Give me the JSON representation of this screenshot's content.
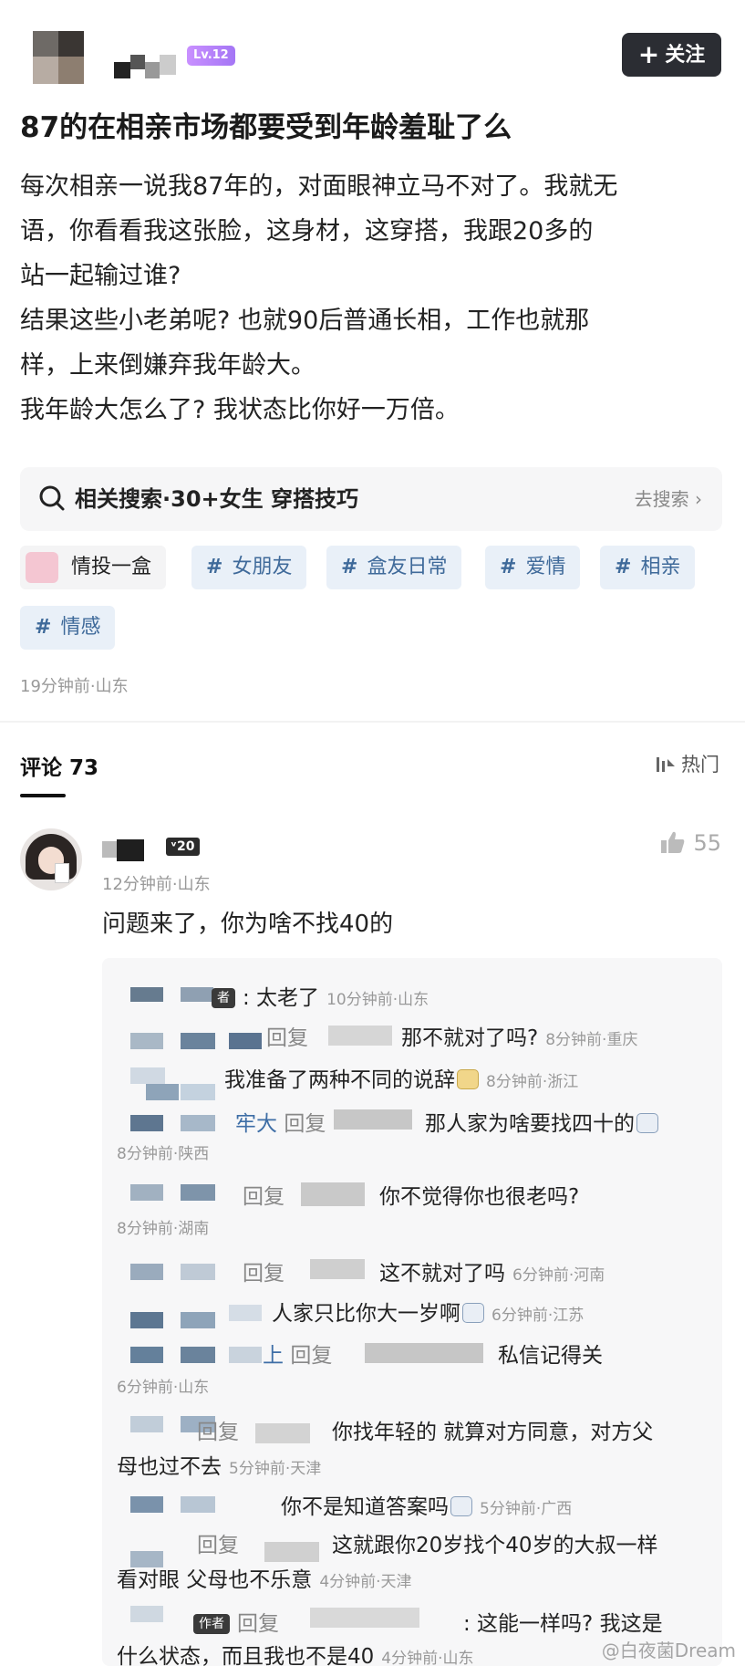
{
  "post": {
    "level": "Lv.12",
    "follow_label": "关注",
    "title": "87的在相亲市场都要受到年龄羞耻了么",
    "body_lines": [
      "每次相亲一说我87年的，对面眼神立马不对了。我就无",
      "语，你看看我这张脸，这身材，这穿搭，我跟20多的",
      "站一起输过谁?",
      "结果这些小老弟呢? 也就90后普通长相，工作也就那",
      "样，上来倒嫌弃我年龄大。",
      "我年龄大怎么了? 我状态比你好一万倍。"
    ],
    "related_search": "相关搜索·30+女生 穿搭技巧",
    "go_search": "去搜索 ›",
    "tags": {
      "album": "情投一盒",
      "t1": "女朋友",
      "t2": "盒友日常",
      "t3": "爱情",
      "t4": "相亲",
      "t5": "情感",
      "hash": "#"
    },
    "time_location": "19分钟前·山东"
  },
  "comments": {
    "header": "评论 73",
    "sort": "热门",
    "top": {
      "level": "ᵛ20",
      "time": "12分钟前·山东",
      "text": "问题来了，你为啥不找40的",
      "likes": "55"
    },
    "replies": {
      "r1_tag": "者",
      "r1_text": ": 太老了",
      "r1_time": "10分钟前·山东",
      "reply_word": "回复",
      "r2_text": "那不就对了吗?",
      "r2_time": "8分钟前·重庆",
      "r3_text": "我准备了两种不同的说辞",
      "r3_time": "8分钟前·浙江",
      "r4_nick": "牢大",
      "r4_text": "那人家为啥要找四十的",
      "r4_time": "8分钟前·陕西",
      "r5_text": "你不觉得你也很老吗?",
      "r5_time": "8分钟前·湖南",
      "r6_text": "这不就对了吗",
      "r6_time": "6分钟前·河南",
      "r7_text": "人家只比你大一岁啊",
      "r7_time": "6分钟前·江苏",
      "r8_nick": "上",
      "r8_text": "私信记得关",
      "r8_time": "6分钟前·山东",
      "r9_text_a": "你找年轻的 就算对方同意，对方父",
      "r9_text_b": "母也过不去",
      "r9_time": "5分钟前·天津",
      "r10_text": "你不是知道答案吗",
      "r10_time": "5分钟前·广西",
      "r11_text_a": "这就跟你20岁找个40岁的大叔一样",
      "r11_text_b": "看对眼 父母也不乐意",
      "r11_time": "4分钟前·天津",
      "r12_tag": "作者",
      "r12_text_a": ": 这能一样吗? 我这是",
      "r12_text_b": "什么状态，而且我也不是40",
      "r12_time": "4分钟前·山东"
    }
  },
  "watermark": "@白夜菌Dream"
}
